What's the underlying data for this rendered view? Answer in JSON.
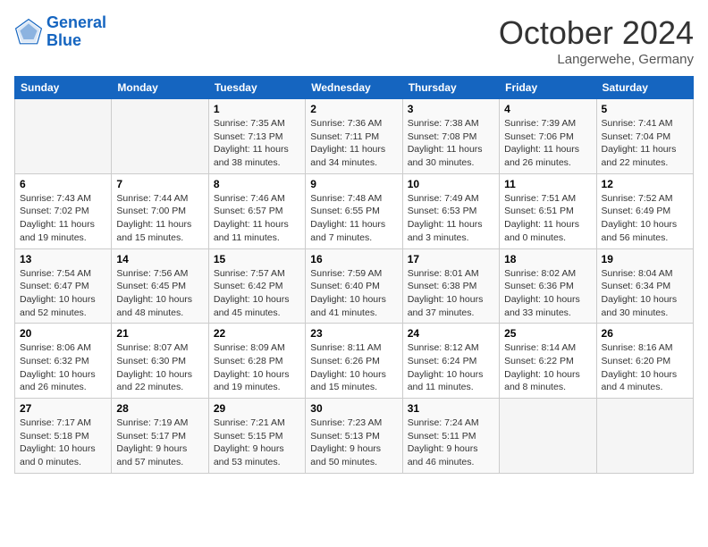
{
  "header": {
    "logo_line1": "General",
    "logo_line2": "Blue",
    "month_title": "October 2024",
    "location": "Langerwehe, Germany"
  },
  "days_of_week": [
    "Sunday",
    "Monday",
    "Tuesday",
    "Wednesday",
    "Thursday",
    "Friday",
    "Saturday"
  ],
  "weeks": [
    [
      {
        "day": "",
        "sunrise": "",
        "sunset": "",
        "daylight": "",
        "empty": true
      },
      {
        "day": "",
        "sunrise": "",
        "sunset": "",
        "daylight": "",
        "empty": true
      },
      {
        "day": "1",
        "sunrise": "Sunrise: 7:35 AM",
        "sunset": "Sunset: 7:13 PM",
        "daylight": "Daylight: 11 hours and 38 minutes."
      },
      {
        "day": "2",
        "sunrise": "Sunrise: 7:36 AM",
        "sunset": "Sunset: 7:11 PM",
        "daylight": "Daylight: 11 hours and 34 minutes."
      },
      {
        "day": "3",
        "sunrise": "Sunrise: 7:38 AM",
        "sunset": "Sunset: 7:08 PM",
        "daylight": "Daylight: 11 hours and 30 minutes."
      },
      {
        "day": "4",
        "sunrise": "Sunrise: 7:39 AM",
        "sunset": "Sunset: 7:06 PM",
        "daylight": "Daylight: 11 hours and 26 minutes."
      },
      {
        "day": "5",
        "sunrise": "Sunrise: 7:41 AM",
        "sunset": "Sunset: 7:04 PM",
        "daylight": "Daylight: 11 hours and 22 minutes."
      }
    ],
    [
      {
        "day": "6",
        "sunrise": "Sunrise: 7:43 AM",
        "sunset": "Sunset: 7:02 PM",
        "daylight": "Daylight: 11 hours and 19 minutes."
      },
      {
        "day": "7",
        "sunrise": "Sunrise: 7:44 AM",
        "sunset": "Sunset: 7:00 PM",
        "daylight": "Daylight: 11 hours and 15 minutes."
      },
      {
        "day": "8",
        "sunrise": "Sunrise: 7:46 AM",
        "sunset": "Sunset: 6:57 PM",
        "daylight": "Daylight: 11 hours and 11 minutes."
      },
      {
        "day": "9",
        "sunrise": "Sunrise: 7:48 AM",
        "sunset": "Sunset: 6:55 PM",
        "daylight": "Daylight: 11 hours and 7 minutes."
      },
      {
        "day": "10",
        "sunrise": "Sunrise: 7:49 AM",
        "sunset": "Sunset: 6:53 PM",
        "daylight": "Daylight: 11 hours and 3 minutes."
      },
      {
        "day": "11",
        "sunrise": "Sunrise: 7:51 AM",
        "sunset": "Sunset: 6:51 PM",
        "daylight": "Daylight: 11 hours and 0 minutes."
      },
      {
        "day": "12",
        "sunrise": "Sunrise: 7:52 AM",
        "sunset": "Sunset: 6:49 PM",
        "daylight": "Daylight: 10 hours and 56 minutes."
      }
    ],
    [
      {
        "day": "13",
        "sunrise": "Sunrise: 7:54 AM",
        "sunset": "Sunset: 6:47 PM",
        "daylight": "Daylight: 10 hours and 52 minutes."
      },
      {
        "day": "14",
        "sunrise": "Sunrise: 7:56 AM",
        "sunset": "Sunset: 6:45 PM",
        "daylight": "Daylight: 10 hours and 48 minutes."
      },
      {
        "day": "15",
        "sunrise": "Sunrise: 7:57 AM",
        "sunset": "Sunset: 6:42 PM",
        "daylight": "Daylight: 10 hours and 45 minutes."
      },
      {
        "day": "16",
        "sunrise": "Sunrise: 7:59 AM",
        "sunset": "Sunset: 6:40 PM",
        "daylight": "Daylight: 10 hours and 41 minutes."
      },
      {
        "day": "17",
        "sunrise": "Sunrise: 8:01 AM",
        "sunset": "Sunset: 6:38 PM",
        "daylight": "Daylight: 10 hours and 37 minutes."
      },
      {
        "day": "18",
        "sunrise": "Sunrise: 8:02 AM",
        "sunset": "Sunset: 6:36 PM",
        "daylight": "Daylight: 10 hours and 33 minutes."
      },
      {
        "day": "19",
        "sunrise": "Sunrise: 8:04 AM",
        "sunset": "Sunset: 6:34 PM",
        "daylight": "Daylight: 10 hours and 30 minutes."
      }
    ],
    [
      {
        "day": "20",
        "sunrise": "Sunrise: 8:06 AM",
        "sunset": "Sunset: 6:32 PM",
        "daylight": "Daylight: 10 hours and 26 minutes."
      },
      {
        "day": "21",
        "sunrise": "Sunrise: 8:07 AM",
        "sunset": "Sunset: 6:30 PM",
        "daylight": "Daylight: 10 hours and 22 minutes."
      },
      {
        "day": "22",
        "sunrise": "Sunrise: 8:09 AM",
        "sunset": "Sunset: 6:28 PM",
        "daylight": "Daylight: 10 hours and 19 minutes."
      },
      {
        "day": "23",
        "sunrise": "Sunrise: 8:11 AM",
        "sunset": "Sunset: 6:26 PM",
        "daylight": "Daylight: 10 hours and 15 minutes."
      },
      {
        "day": "24",
        "sunrise": "Sunrise: 8:12 AM",
        "sunset": "Sunset: 6:24 PM",
        "daylight": "Daylight: 10 hours and 11 minutes."
      },
      {
        "day": "25",
        "sunrise": "Sunrise: 8:14 AM",
        "sunset": "Sunset: 6:22 PM",
        "daylight": "Daylight: 10 hours and 8 minutes."
      },
      {
        "day": "26",
        "sunrise": "Sunrise: 8:16 AM",
        "sunset": "Sunset: 6:20 PM",
        "daylight": "Daylight: 10 hours and 4 minutes."
      }
    ],
    [
      {
        "day": "27",
        "sunrise": "Sunrise: 7:17 AM",
        "sunset": "Sunset: 5:18 PM",
        "daylight": "Daylight: 10 hours and 0 minutes."
      },
      {
        "day": "28",
        "sunrise": "Sunrise: 7:19 AM",
        "sunset": "Sunset: 5:17 PM",
        "daylight": "Daylight: 9 hours and 57 minutes."
      },
      {
        "day": "29",
        "sunrise": "Sunrise: 7:21 AM",
        "sunset": "Sunset: 5:15 PM",
        "daylight": "Daylight: 9 hours and 53 minutes."
      },
      {
        "day": "30",
        "sunrise": "Sunrise: 7:23 AM",
        "sunset": "Sunset: 5:13 PM",
        "daylight": "Daylight: 9 hours and 50 minutes."
      },
      {
        "day": "31",
        "sunrise": "Sunrise: 7:24 AM",
        "sunset": "Sunset: 5:11 PM",
        "daylight": "Daylight: 9 hours and 46 minutes."
      },
      {
        "day": "",
        "sunrise": "",
        "sunset": "",
        "daylight": "",
        "empty": true
      },
      {
        "day": "",
        "sunrise": "",
        "sunset": "",
        "daylight": "",
        "empty": true
      }
    ]
  ]
}
